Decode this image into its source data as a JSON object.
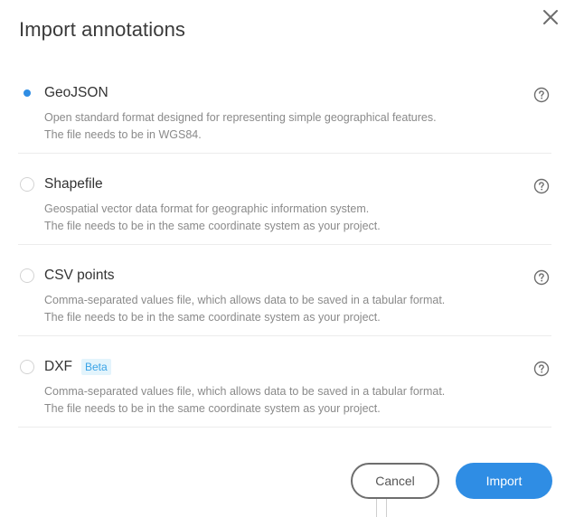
{
  "dialog": {
    "title": "Import annotations",
    "close_icon": "close-icon"
  },
  "options": [
    {
      "title": "GeoJSON",
      "selected": true,
      "badge": "",
      "desc_line1": "Open standard format designed for representing simple geographical features.",
      "desc_line2": "The file needs to be in WGS84."
    },
    {
      "title": "Shapefile",
      "selected": false,
      "badge": "",
      "desc_line1": "Geospatial vector data format for geographic information system.",
      "desc_line2": "The file needs to be in the same coordinate system as your project."
    },
    {
      "title": "CSV points",
      "selected": false,
      "badge": "",
      "desc_line1": "Comma-separated values file, which allows data to be saved in a tabular format.",
      "desc_line2": "The file needs to be in the same coordinate system as your project."
    },
    {
      "title": "DXF",
      "selected": false,
      "badge": "Beta",
      "desc_line1": "Comma-separated values file, which allows data to be saved in a tabular format.",
      "desc_line2": "The file needs to be in the same coordinate system as your project."
    }
  ],
  "footer": {
    "cancel_label": "Cancel",
    "import_label": "Import"
  },
  "colors": {
    "accent": "#2f8de4",
    "badge_text": "#3aa3e6",
    "badge_bg": "#e3f4fc"
  },
  "icons": {
    "help": "help-circle-icon",
    "close": "close-icon"
  }
}
